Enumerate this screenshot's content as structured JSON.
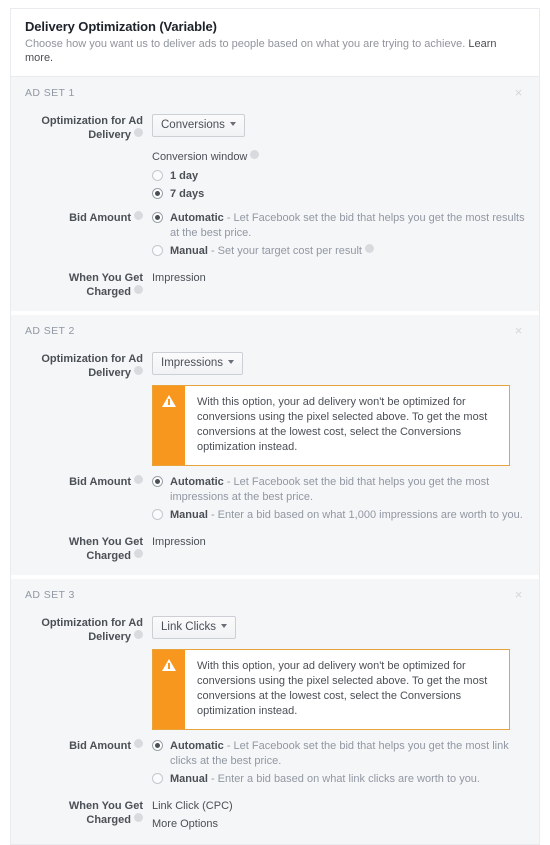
{
  "header": {
    "title": "Delivery Optimization (Variable)",
    "subtitle": "Choose how you want us to deliver ads to people based on what you are trying to achieve.",
    "learn_more": "Learn more."
  },
  "labels": {
    "optimization": "Optimization for Ad Delivery",
    "bid_amount": "Bid Amount",
    "when_charged": "When You Get Charged",
    "conversion_window": "Conversion window",
    "close": "×"
  },
  "colors": {
    "accent_warning": "#f7971e",
    "warning_border": "#e8a33d",
    "card_bg": "#f5f6f7",
    "text_primary": "#4b4f56",
    "text_muted": "#9197a3"
  },
  "warning_message": "With this option, your ad delivery won't be optimized for conversions using the pixel selected above. To get the most conversions at the lowest cost, select the Conversions optimization instead.",
  "adsets": [
    {
      "name": "AD SET 1",
      "optimization_value": "Conversions",
      "has_warning": false,
      "conversion_window": {
        "title": "Conversion window",
        "options": [
          {
            "label": "1 day",
            "checked": false
          },
          {
            "label": "7 days",
            "checked": true
          }
        ]
      },
      "bid_options": [
        {
          "strong": "Automatic",
          "rest": " - Let Facebook set the bid that helps you get the most results at the best price.",
          "checked": true,
          "info": false
        },
        {
          "strong": "Manual",
          "rest": " - Set your target cost per result",
          "checked": false,
          "info": true
        }
      ],
      "when_charged_value": "Impression",
      "more_options": null
    },
    {
      "name": "AD SET 2",
      "optimization_value": "Impressions",
      "has_warning": true,
      "conversion_window": null,
      "bid_options": [
        {
          "strong": "Automatic",
          "rest": " - Let Facebook set the bid that helps you get the most impressions at the best price.",
          "checked": true,
          "info": false
        },
        {
          "strong": "Manual",
          "rest": " - Enter a bid based on what 1,000 impressions are worth to you.",
          "checked": false,
          "info": false
        }
      ],
      "when_charged_value": "Impression",
      "more_options": null
    },
    {
      "name": "AD SET 3",
      "optimization_value": "Link Clicks",
      "has_warning": true,
      "conversion_window": null,
      "bid_options": [
        {
          "strong": "Automatic",
          "rest": " - Let Facebook set the bid that helps you get the most link clicks at the best price.",
          "checked": true,
          "info": false
        },
        {
          "strong": "Manual",
          "rest": " - Enter a bid based on what link clicks are worth to you.",
          "checked": false,
          "info": false
        }
      ],
      "when_charged_value": "Link Click (CPC)",
      "more_options": "More Options"
    }
  ]
}
